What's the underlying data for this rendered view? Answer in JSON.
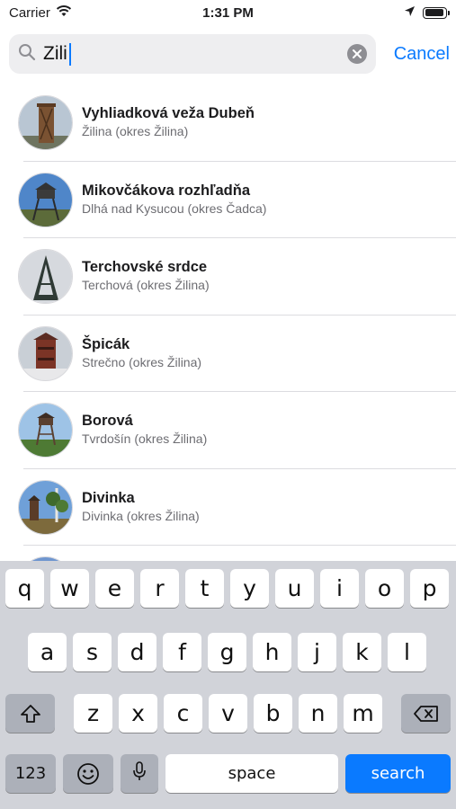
{
  "status_bar": {
    "carrier": "Carrier",
    "time": "1:31 PM",
    "battery_level_fraction": 0.95
  },
  "search": {
    "query": "Zili",
    "cancel_label": "Cancel",
    "icons": [
      "search-icon",
      "clear-icon"
    ]
  },
  "results": [
    {
      "title": "Vyhliadková veža Dubeň",
      "subtitle": "Žilina (okres Žilina)"
    },
    {
      "title": "Mikovčákova rozhľadňa",
      "subtitle": "Dlhá nad Kysucou (okres Čadca)"
    },
    {
      "title": "Terchovské srdce",
      "subtitle": "Terchová (okres Žilina)"
    },
    {
      "title": "Špicák",
      "subtitle": "Strečno (okres Žilina)"
    },
    {
      "title": "Borová",
      "subtitle": "Tvrdošín (okres Žilina)"
    },
    {
      "title": "Divinka",
      "subtitle": "Divinka (okres Žilina)"
    }
  ],
  "keyboard": {
    "row1": [
      "q",
      "w",
      "e",
      "r",
      "t",
      "y",
      "u",
      "i",
      "o",
      "p"
    ],
    "row2": [
      "a",
      "s",
      "d",
      "f",
      "g",
      "h",
      "j",
      "k",
      "l"
    ],
    "row3": [
      "z",
      "x",
      "c",
      "v",
      "b",
      "n",
      "m"
    ],
    "numbers_label": "123",
    "space_label": "space",
    "search_label": "search"
  },
  "colors": {
    "accent": "#0a7aff",
    "keyboard_bg": "#d1d3d9"
  }
}
